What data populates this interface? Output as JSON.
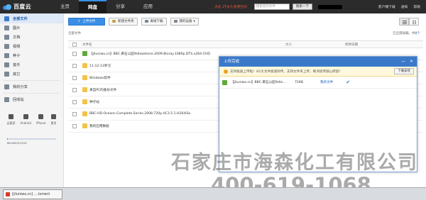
{
  "app": {
    "logo": "百度云"
  },
  "nav": [
    "主页",
    "网盘",
    "分享",
    "应用"
  ],
  "promo": "点此 2T永久免费空间",
  "search": {
    "placeholder": "搜索您的文件",
    "button": "搜索一下"
  },
  "top_right": [
    "客户端下载",
    "通知",
    "帮助"
  ],
  "sidebar": {
    "items": [
      {
        "label": "全部文件",
        "active": true
      },
      {
        "label": "图片"
      },
      {
        "label": "文档"
      },
      {
        "label": "视频"
      },
      {
        "label": "种子"
      },
      {
        "label": "音乐"
      },
      {
        "label": "其它"
      }
    ],
    "share": "我的分享",
    "recycle": "回收站",
    "devices": [
      "云管家",
      "Android",
      "iPhone",
      "更多"
    ],
    "quota_text": "68.98G/5130G",
    "quota_fraction": 0.013
  },
  "toolbar": {
    "upload": "上传文件",
    "new_folder": "新建文件夹",
    "offline": "离线下载",
    "my_devices": "我的设备"
  },
  "breadcrumb": "全部文件",
  "loaded": {
    "prefix": "已全部加载，共",
    "count": "8",
    "suffix": "个"
  },
  "table": {
    "headers": {
      "name": "文件名",
      "size": "大小",
      "date": "修改日期"
    },
    "rows": [
      {
        "name": "【jiluniwo.cn】BBC.黄石公园Yellowstone.2009.Bluray.1080p.DTS.x264-CHD",
        "type": "torrent"
      },
      {
        "name": "11-12-13罗汉",
        "type": "folder"
      },
      {
        "name": "Windows软件",
        "type": "folder"
      },
      {
        "name": "来自PC的备份文件",
        "type": "folder"
      },
      {
        "name": "种子站",
        "type": "folder"
      },
      {
        "name": "BBC-HD.Oceans.Complete.Series.2008.720p.AC3.5.1.H264iSa",
        "type": "folder"
      },
      {
        "name": "我的应用数据",
        "type": "folder"
      }
    ]
  },
  "dialog": {
    "title": "上传完成",
    "minimize": "—",
    "close": "×",
    "banner": "支持极速上传啦！4G大文件极速秒传，支持文件夹上传，断点续传随心所欲！",
    "download_btn": "下载安装",
    "upload": {
      "name": "【jiluniwo.cn】BBC.黄石公园Yello...",
      "size": "72KB",
      "location": "我的文件",
      "status": "✔"
    }
  },
  "watermark": {
    "line1": "石家庄市海森化工有限公司",
    "line2": "400-619-1068"
  },
  "taskbar": {
    "item": "[jiluniwo.cn] ....torrent"
  },
  "colors": {
    "accent": "#3a79c9",
    "topbar": "#2b2b2b",
    "promo": "#e9503a"
  }
}
